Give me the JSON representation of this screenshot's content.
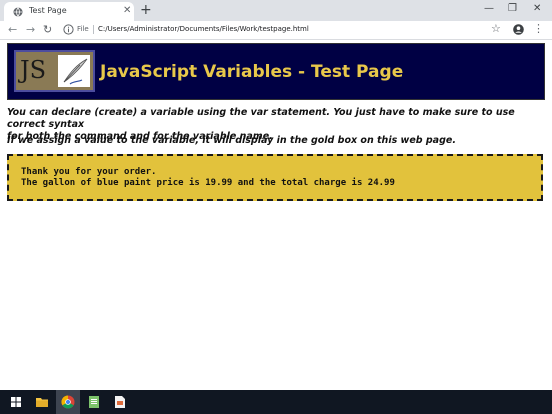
{
  "browser": {
    "tab_title": "Test Page",
    "new_tab_symbol": "+",
    "url_scheme": "File",
    "url": "C:/Users/Administrator/Documents/Files/Work/testpage.html",
    "icons": [
      "globe-icon",
      "close-icon",
      "minimize-icon",
      "restore-icon",
      "back-icon",
      "forward-icon",
      "reload-icon",
      "info-icon",
      "star-icon",
      "profile-icon",
      "menu-icon"
    ]
  },
  "page": {
    "header_title": "JavaScript Variables - Test Page",
    "logo_text": "JS",
    "paragraph1_line1": "You can declare (create) a variable using the var statement. You just have to make sure to use correct syntax",
    "paragraph1_line2": "for both the command and for the variable name.",
    "paragraph2": "If we assign a value to the variable, it will display in the gold box on this web page.",
    "gold_line1": "Thank you for your order.",
    "gold_line2": "The gallon of blue paint price is 19.99 and the total charge is 24.99"
  },
  "colors": {
    "header_bg": "#000044",
    "header_title": "#e8c84a",
    "gold_box": "#e2c23c",
    "taskbar": "#101722"
  },
  "taskbar": {
    "icons": [
      "windows-start-icon",
      "file-explorer-icon",
      "chrome-icon",
      "notepad-icon",
      "document-icon"
    ]
  }
}
